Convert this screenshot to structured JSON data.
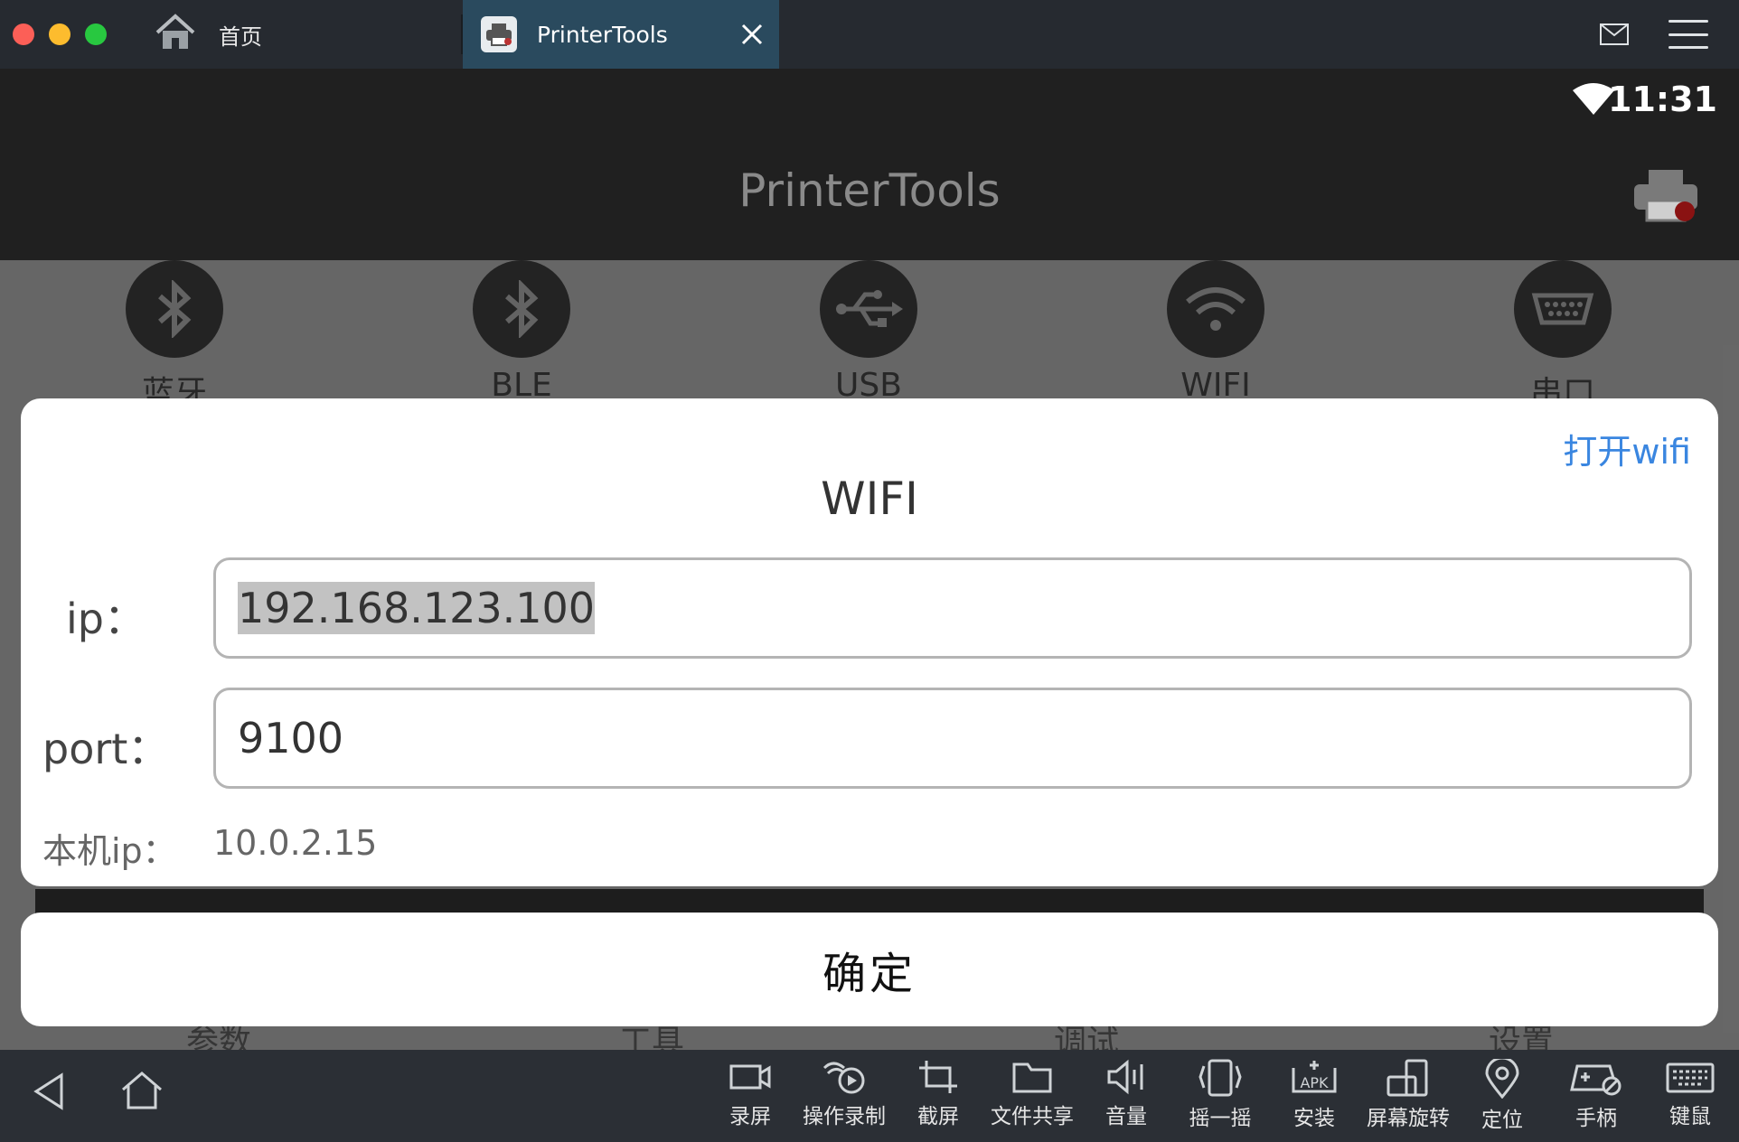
{
  "host": {
    "tabs": [
      {
        "label": "首页",
        "icon": "home-icon"
      },
      {
        "label": "PrinterTools",
        "icon": "printer-app-icon",
        "active": true
      }
    ],
    "toolbar": [
      {
        "label": "录屏",
        "icon": "screen-record-icon"
      },
      {
        "label": "操作录制",
        "icon": "operation-record-icon"
      },
      {
        "label": "截屏",
        "icon": "crop-icon"
      },
      {
        "label": "文件共享",
        "icon": "folder-icon"
      },
      {
        "label": "音量",
        "icon": "volume-icon"
      },
      {
        "label": "摇一摇",
        "icon": "shake-icon"
      },
      {
        "label": "安装",
        "icon": "apk-install-icon"
      },
      {
        "label": "屏幕旋转",
        "icon": "rotate-screen-icon"
      },
      {
        "label": "定位",
        "icon": "location-icon"
      },
      {
        "label": "手柄",
        "icon": "gamepad-icon"
      },
      {
        "label": "键鼠",
        "icon": "keyboard-icon"
      }
    ]
  },
  "android": {
    "status": {
      "time": "11:31"
    },
    "app_title": "PrinterTools",
    "connections": [
      {
        "label": "蓝牙",
        "icon": "bluetooth-icon"
      },
      {
        "label": "BLE",
        "icon": "bluetooth-icon"
      },
      {
        "label": "USB",
        "icon": "usb-icon"
      },
      {
        "label": "WIFI",
        "icon": "wifi-icon"
      },
      {
        "label": "串口",
        "icon": "serial-port-icon"
      }
    ],
    "bottom_tabs": [
      "参数",
      "工具",
      "调试",
      "设置"
    ]
  },
  "dialog": {
    "open_wifi": "打开wifi",
    "title": "WIFI",
    "ip_label": "ip：",
    "ip_value": "192.168.123.100",
    "port_label": "port：",
    "port_value": "9100",
    "local_ip_label": "本机ip：",
    "local_ip_value": "10.0.2.15",
    "confirm": "确定"
  },
  "colors": {
    "link": "#3a86e0",
    "appbar": "#202020",
    "host_chrome": "#262a30",
    "active_tab": "#2a4a5e"
  }
}
